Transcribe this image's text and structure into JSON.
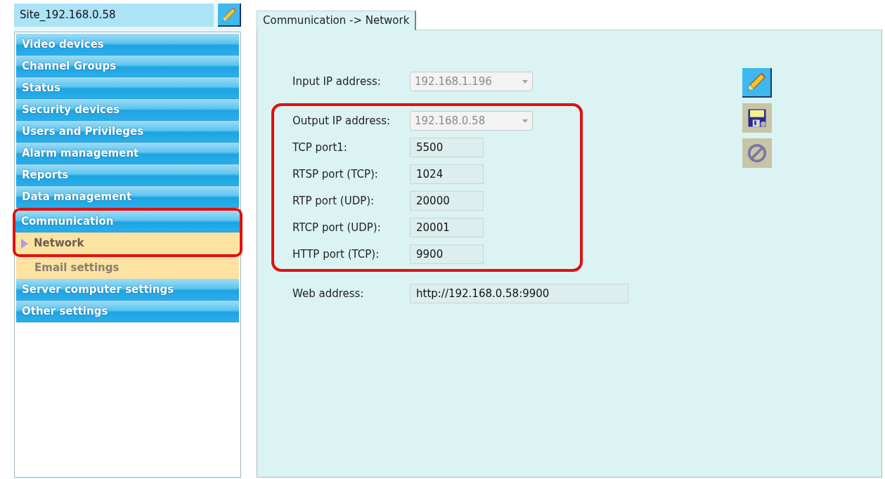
{
  "site": {
    "name": "Site_192.168.0.58"
  },
  "menu": [
    {
      "label": "Video devices",
      "kind": "group",
      "highlighted": false
    },
    {
      "label": "Channel Groups",
      "kind": "group",
      "highlighted": false
    },
    {
      "label": "Status",
      "kind": "group",
      "highlighted": false
    },
    {
      "label": "Security devices",
      "kind": "group",
      "highlighted": false
    },
    {
      "label": "Users and Privileges",
      "kind": "group",
      "highlighted": false
    },
    {
      "label": "Alarm management",
      "kind": "group",
      "highlighted": false
    },
    {
      "label": "Reports",
      "kind": "group",
      "highlighted": false
    },
    {
      "label": "Data management",
      "kind": "group",
      "highlighted": false
    },
    {
      "label": "Communication",
      "kind": "group",
      "highlighted": true
    },
    {
      "label": "Network",
      "kind": "subitem",
      "selected": true,
      "highlighted": true
    },
    {
      "label": "Email settings",
      "kind": "subitem",
      "selected": false,
      "highlighted": false
    },
    {
      "label": "Server computer settings",
      "kind": "group",
      "highlighted": false
    },
    {
      "label": "Other settings",
      "kind": "group",
      "highlighted": false
    }
  ],
  "tab": {
    "label": "Communication -> Network"
  },
  "fields": [
    {
      "label": "Input IP address:",
      "value": "192.168.1.196",
      "kind": "dropdown",
      "highlighted": false
    },
    {
      "label": "Output IP address:",
      "value": "192.168.0.58",
      "kind": "dropdown",
      "highlighted": true
    },
    {
      "label": "TCP port1:",
      "value": "5500",
      "kind": "text",
      "highlighted": true
    },
    {
      "label": "RTSP port (TCP):",
      "value": "1024",
      "kind": "text",
      "highlighted": true
    },
    {
      "label": "RTP port (UDP):",
      "value": "20000",
      "kind": "text",
      "highlighted": true
    },
    {
      "label": "RTCP port (UDP):",
      "value": "20001",
      "kind": "text",
      "highlighted": true
    },
    {
      "label": "HTTP port (TCP):",
      "value": "9900",
      "kind": "text",
      "highlighted": true
    },
    {
      "label": "Web address:",
      "value": "http://192.168.0.58:9900",
      "kind": "wide",
      "highlighted": false
    }
  ],
  "toolbar": [
    {
      "kind": "edit",
      "disabled": false
    },
    {
      "kind": "save",
      "disabled": true
    },
    {
      "kind": "cancel",
      "disabled": true
    }
  ]
}
